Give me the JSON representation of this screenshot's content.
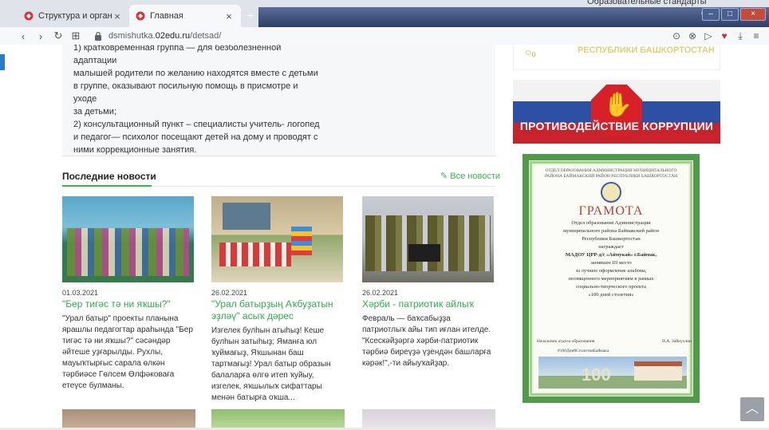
{
  "browser": {
    "tabs": [
      {
        "label": "Структура и органы упра",
        "active": false
      },
      {
        "label": "Главная",
        "active": true
      }
    ],
    "new_tab_glyph": "+",
    "url_host_prefix": "dsmishutka.",
    "url_host_domain": "02edu.ru",
    "url_path": "/detsad/",
    "peek_text": "Образовательные стандарты"
  },
  "page": {
    "info_lines": [
      "1) кратковременная группа — для безболезненной адаптации",
      "малышей родители по желанию находятся вместе с детьми",
      "в группе, оказывают посильную помощь в присмотре и уходе",
      "за детьми;",
      "2) консультационный пункт – специалисты учитель- логопед",
      "и педагог— психолог посещают детей на дому и проводят с",
      "ними коррекционные занятия."
    ],
    "news_heading": "Последние новости",
    "all_news_link": "✎ Все новости",
    "news": [
      {
        "date": "01.03.2021",
        "title": "\"Бер тигәс тә ни яҡшы?\"",
        "excerpt": "\"Урал батыр\" проекты планына ярашлы педагогтар араһында \"Бер тигәс тә ни яҡшы?\" сәсәндәр әйтеше уҙғарылды. Рухлы, мауыҡтырғыс сарала өлкән тәрбиәсе Гөлсем Өлфәковаға етеүсе булманы."
      },
      {
        "date": "26.02.2021",
        "title": "\"Урал батырҙың Аҡбуҙатын эҙләү\" асыҡ дәрес",
        "excerpt": "Изгелек булһын атыһыҙ! Кеше булһын затыһыҙ; Яманға юл ҡуймағыҙ, Яҡшынан баш тартмағыҙ! Урал батыр образын балаларға өлгө итеп ҡуйыу, изгелек, яҡшылыҡ сифаттары менән батырға оҡша..."
      },
      {
        "date": "26.02.2021",
        "title": "Хәрби - патриотик айлыҡ",
        "excerpt": "Февраль — баҡсабыҙҙа патриотлыҡ айы тип иғлан ителде. \"Ксескәйҙәргә хәрби-патриотик тәрбиә биреүҙә үҙендән башларға кәрәк!\",-ти айыуҡайҙар."
      }
    ]
  },
  "sidebar": {
    "top_banner_text": "РЕСПУБЛИКИ БАШКОРТОСТАН",
    "corruption_banner_text": "ПРОТИВОДЕЙСТВИЕ КОРРУПЦИИ",
    "gramota": {
      "header": "ОТДЕЛ ОБРАЗОВАНИЯ АДМИНИСТРАЦИИ МУНИЦИПАЛЬНОГО РАЙОНА БАЙМАКСКИЙ РАЙОН РЕСПУБЛИКИ БАШКОРТОСТАН",
      "title": "ГРАМОТА",
      "issuer_lines": [
        "Отдел образования Администрации",
        "муниципального района Баймакский район",
        "Республики Башкортостан"
      ],
      "award_word": "награждает",
      "recipient": "МАДОУ ЦРР-д/с «Аймукай» г.Баймак,",
      "body_lines": [
        "занявшее III место",
        "за лучшее оформление альбома,",
        "посвященного мероприятиям в рамках",
        "социально-творческого проекта",
        "«100 дней столетия»"
      ],
      "signer_role": "Начальник отдела образования",
      "signer_name": "И.А. Зайнуллин",
      "hashtag": "#100ДнейСтолетияБаймака",
      "number": "100"
    }
  },
  "colors": {
    "accent_green": "#39b54a",
    "heart_red": "#d62b3a"
  },
  "icons": {
    "scroll_top": "chevron-up-icon"
  }
}
